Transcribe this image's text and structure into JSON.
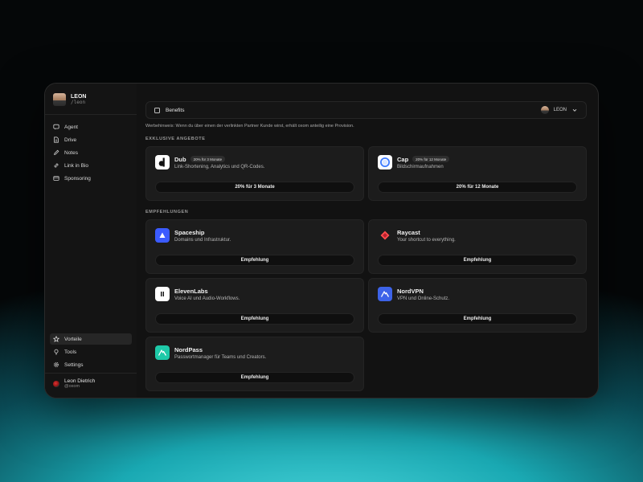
{
  "sidebar": {
    "profile": {
      "name": "LEON",
      "handle": "/leon"
    },
    "items": [
      {
        "label": "Agent",
        "icon": "chat-icon"
      },
      {
        "label": "Drive",
        "icon": "file-icon"
      },
      {
        "label": "Notes",
        "icon": "pencil-icon"
      },
      {
        "label": "Link in Bio",
        "icon": "link-icon"
      },
      {
        "label": "Sponsoring",
        "icon": "card-icon"
      }
    ],
    "bottom_items": [
      {
        "label": "Vorteile",
        "icon": "star-icon",
        "active": true
      },
      {
        "label": "Tools",
        "icon": "bulb-icon"
      },
      {
        "label": "Settings",
        "icon": "gear-icon"
      }
    ],
    "user": {
      "name": "Leon Dietrich",
      "email": "@oxom"
    }
  },
  "topbar": {
    "title": "Benefits",
    "user": "LEON"
  },
  "hint": "Werbehinweis: Wenn du über einen der verlinkten Partner Kunde wirst, erhält oxom anteilig eine Provision.",
  "exclusive": {
    "title": "EXKLUSIVE ANGEBOTE",
    "cards": [
      {
        "name": "Dub",
        "badge": "20% für 3 Monate",
        "desc": "Link-Shortening, Analytics und QR-Codes.",
        "button": "20% für 3 Monate"
      },
      {
        "name": "Cap",
        "badge": "20% für 12 Monate",
        "desc": "Bildschirmaufnahmen",
        "button": "20% für 12 Monate"
      }
    ]
  },
  "recommendations": {
    "title": "EMPFEHLUNGEN",
    "cards": [
      {
        "name": "Spaceship",
        "desc": "Domains und Infrastruktur.",
        "button": "Empfehlung"
      },
      {
        "name": "Raycast",
        "desc": "Your shortcut to everything.",
        "button": "Empfehlung"
      },
      {
        "name": "ElevenLabs",
        "desc": "Voice AI und Audio-Workflows.",
        "button": "Empfehlung"
      },
      {
        "name": "NordVPN",
        "desc": "VPN und Online-Schutz.",
        "button": "Empfehlung"
      },
      {
        "name": "NordPass",
        "desc": "Passwortmanager für Teams und Creators.",
        "button": "Empfehlung"
      }
    ]
  },
  "colors": {
    "spaceship": "#3b5bff",
    "raycast": "#ff4d4d",
    "nordvpn": "#3d63e8",
    "nordpass": "#1ec9a8",
    "cap": "#3d7bff"
  }
}
